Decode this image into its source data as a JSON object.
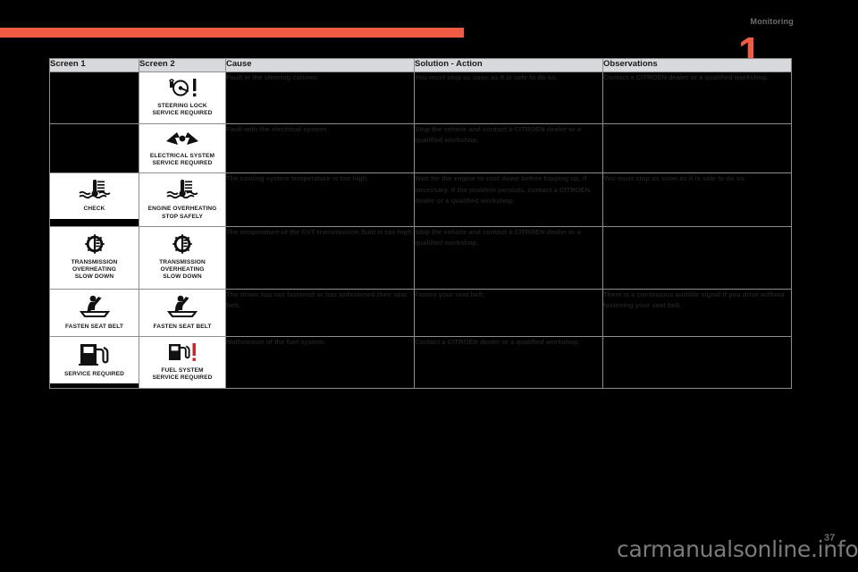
{
  "page": {
    "chapter_label": "Monitoring",
    "chapter_number": "1",
    "page_number": "37",
    "watermark": "carmanualsonline.info",
    "accent_color": "#ef5b43",
    "header_bg": "#d7d9dc",
    "background": "#000000"
  },
  "table": {
    "headers": [
      "Screen 1",
      "Screen 2",
      "Cause",
      "Solution - Action",
      "Observations"
    ],
    "rows": [
      {
        "screen1": null,
        "screen2": {
          "icon": "steering-lock-warning-icon",
          "caption": "STEERING LOCK\nSERVICE REQUIRED"
        },
        "cause": "Fault in the steering column.",
        "solution": "You must stop as soon as it is safe to do so.",
        "observations": "Contact a CITROËN dealer or a qualified workshop."
      },
      {
        "screen1": null,
        "screen2": {
          "icon": "electrical-system-warning-icon",
          "caption": "ELECTRICAL SYSTEM\nSERVICE REQUIRED"
        },
        "cause": "Fault with the electrical system.",
        "solution": "Stop the vehicle and contact a CITROËN dealer or a qualified workshop.",
        "observations": ""
      },
      {
        "screen1": {
          "icon": "coolant-temperature-warning-icon",
          "caption": "CHECK"
        },
        "screen2": {
          "icon": "coolant-temperature-warning-icon",
          "caption": "ENGINE OVERHEATING\nSTOP SAFELY"
        },
        "cause": "The cooling system temperature is too high.",
        "solution": "Wait for the engine to cool down before topping up, if necessary. If the problem persists, contact a CITROËN dealer or a qualified workshop.",
        "observations": "You must stop as soon as it is safe to do so."
      },
      {
        "screen1": {
          "icon": "transmission-overheating-icon",
          "caption": "TRANSMISSION\nOVERHEATING\nSLOW DOWN"
        },
        "screen2": {
          "icon": "transmission-overheating-icon",
          "caption": "TRANSMISSION\nOVERHEATING\nSLOW DOWN"
        },
        "cause": "The temperature of the CVT transmission fluid is too high.",
        "solution": "Stop the vehicle and contact a CITROËN dealer or a qualified workshop.",
        "observations": ""
      },
      {
        "screen1": {
          "icon": "fasten-seat-belt-icon",
          "caption": "FASTEN SEAT BELT"
        },
        "screen2": {
          "icon": "fasten-seat-belt-icon",
          "caption": "FASTEN SEAT BELT"
        },
        "cause": "The driver has not fastened or has unfastened their seat belt.",
        "solution": "Fasten your seat belt.",
        "observations": "There is a continuous audible signal if you drive without fastening your seat belt."
      },
      {
        "screen1": {
          "icon": "fuel-pump-service-icon",
          "caption": "SERVICE REQUIRED"
        },
        "screen2": {
          "icon": "fuel-system-service-icon",
          "caption": "FUEL SYSTEM\nSERVICE REQUIRED"
        },
        "cause": "Malfunction of the fuel system.",
        "solution": "Contact a CITROËN dealer or a qualified workshop.",
        "observations": ""
      }
    ]
  }
}
